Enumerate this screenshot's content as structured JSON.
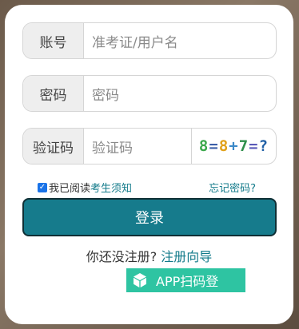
{
  "form": {
    "account_label": "账号",
    "account_placeholder": "准考证/用户名",
    "password_label": "密码",
    "password_placeholder": "密码",
    "captcha_label": "验证码",
    "captcha_placeholder": "验证码",
    "captcha_text": [
      "8",
      "=",
      "8",
      "+",
      "7",
      "=",
      "?"
    ],
    "captcha_colors": [
      "#3aa74a",
      "#3c5fa8",
      "#e0a018",
      "#3c89c8",
      "#2e8f4b",
      "#5a5ab8",
      "#1f5fa6"
    ]
  },
  "agree": {
    "checked": true,
    "text": "我已阅读",
    "link": "考生须知"
  },
  "forgot_password": "忘记密码?",
  "login_button": "登录",
  "register": {
    "prompt": "你还没注册?",
    "link": "注册向导"
  },
  "app_button": {
    "label": "APP扫码登",
    "icon": "cube-icon"
  }
}
